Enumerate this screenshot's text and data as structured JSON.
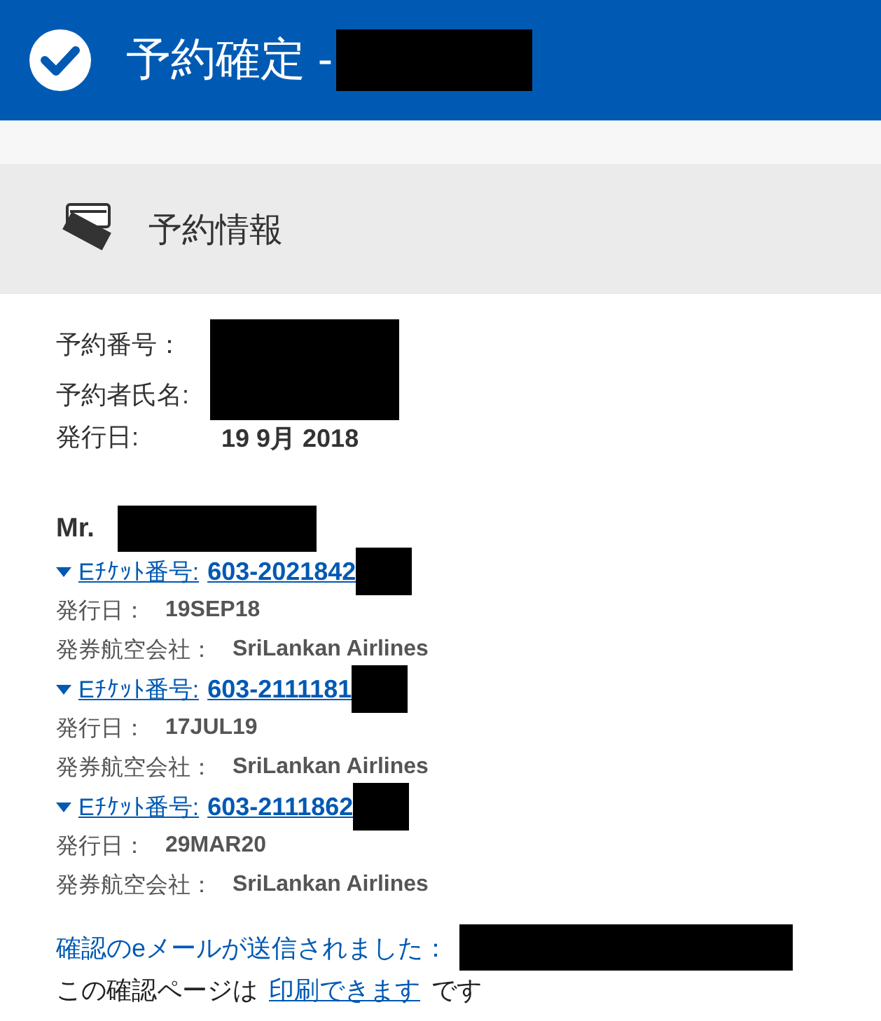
{
  "header": {
    "title": "予約確定 -"
  },
  "section": {
    "title": "予約情報"
  },
  "booking": [
    {
      "label": "予約番号："
    },
    {
      "label": "予約者氏名:"
    },
    {
      "label": "発行日:",
      "value": "19 9月 2018"
    }
  ],
  "passenger": {
    "name": "Mr."
  },
  "tickets": [
    {
      "label": "Eﾁｹｯﾄ番号:",
      "number": "603-2021842",
      "issue_label": "発行日：",
      "issue_date": "19SEP18",
      "airline_label": "発券航空会社：",
      "airline": "SriLankan Airlines"
    },
    {
      "label": "Eﾁｹｯﾄ番号:",
      "number": "603-2111181",
      "issue_label": "発行日：",
      "issue_date": "17JUL19",
      "airline_label": "発券航空会社：",
      "airline": "SriLankan Airlines"
    },
    {
      "label": "Eﾁｹｯﾄ番号:",
      "number": "603-2111862",
      "issue_label": "発行日：",
      "issue_date": "29MAR20",
      "airline_label": "発券航空会社：",
      "airline": "SriLankan Airlines"
    }
  ],
  "email_notice": "確認のeメールが送信されました：",
  "print_note": {
    "before": "この確認ページは",
    "link": "印刷できます",
    "after": "です"
  }
}
